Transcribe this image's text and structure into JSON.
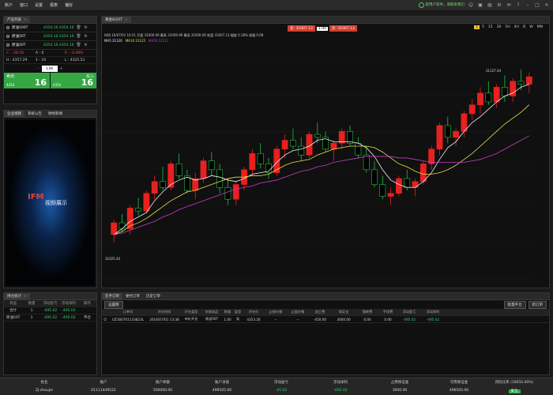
{
  "menu": [
    "账户",
    "窗口",
    "设置",
    "报表",
    "偏好"
  ],
  "status": {
    "text": "帮用户软件，请联系我们"
  },
  "products": {
    "tab": "产品列表",
    "rows": [
      {
        "name": "原油100T",
        "bid": "4354.16",
        "ask": "4354.16"
      },
      {
        "name": "原油50T",
        "bid": "4354.16",
        "ask": "4354.16"
      },
      {
        "name": "原油20T",
        "bid": "4354.16",
        "ask": "4354.16"
      }
    ],
    "stats1": [
      "C : -28.59",
      "A : 0",
      "R : -0.48%"
    ],
    "stats2": [
      "H : 4357.29",
      "1 - 10",
      "L : 4325.51"
    ],
    "qty": "1.00",
    "sell": {
      "label": "卖出",
      "big": "16",
      "small": "4354"
    },
    "buy": {
      "label": "买入",
      "big": "16",
      "small": "4354"
    }
  },
  "news": {
    "tabs": [
      "企业视频",
      "系统公告",
      "财经新闻"
    ],
    "video_label": "视频展示",
    "logo_text": "IFM"
  },
  "chart_panel": {
    "tab": "黄金8/20T",
    "sell_label": "卖: 31007.13",
    "qty": "1.00",
    "buy_label": "买: 31007.13",
    "periods": [
      "1",
      "5",
      "15",
      "30",
      "1H",
      "4H",
      "D",
      "W",
      "MN"
    ],
    "active_period": "1",
    "info": "时间 16/07/01 10:51  开盘 31000.00  最高 31009.99  最低 31000.00  收盘 31007.13  幅度 0.18%  振幅 0.08",
    "ma": [
      {
        "text": "MA5 31120",
        "color": "#f0f0f0"
      },
      {
        "text": "MA10 31125",
        "color": "#e8e04a"
      },
      {
        "text": "MA20 31111",
        "color": "#c040c0"
      }
    ],
    "price_left": "31025.44",
    "price_right": "31127.44"
  },
  "chart_data": {
    "type": "candlestick",
    "ylim": [
      30990,
      31140
    ],
    "candles": [
      [
        31020,
        31030,
        31015,
        31028
      ],
      [
        31028,
        31034,
        31022,
        31024
      ],
      [
        31024,
        31040,
        31020,
        31038
      ],
      [
        31038,
        31045,
        31033,
        31036
      ],
      [
        31036,
        31050,
        31034,
        31048
      ],
      [
        31048,
        31060,
        31044,
        31056
      ],
      [
        31056,
        31066,
        31050,
        31052
      ],
      [
        31052,
        31070,
        31050,
        31068
      ],
      [
        31068,
        31075,
        31058,
        31060
      ],
      [
        31060,
        31064,
        31048,
        31050
      ],
      [
        31050,
        31062,
        31044,
        31058
      ],
      [
        31058,
        31072,
        31055,
        31070
      ],
      [
        31070,
        31076,
        31060,
        31064
      ],
      [
        31064,
        31068,
        31048,
        31052
      ],
      [
        31052,
        31058,
        31040,
        31044
      ],
      [
        31044,
        31056,
        31040,
        31054
      ],
      [
        31054,
        31066,
        31050,
        31064
      ],
      [
        31064,
        31078,
        31060,
        31075
      ],
      [
        31075,
        31082,
        31065,
        31068
      ],
      [
        31068,
        31072,
        31058,
        31062
      ],
      [
        31062,
        31080,
        31060,
        31078
      ],
      [
        31078,
        31088,
        31072,
        31084
      ],
      [
        31084,
        31092,
        31078,
        31080
      ],
      [
        31080,
        31086,
        31070,
        31074
      ],
      [
        31074,
        31090,
        31072,
        31088
      ],
      [
        31088,
        31096,
        31082,
        31086
      ],
      [
        31086,
        31090,
        31076,
        31078
      ],
      [
        31078,
        31084,
        31070,
        31082
      ],
      [
        31082,
        31092,
        31078,
        31090
      ],
      [
        31090,
        31094,
        31080,
        31082
      ],
      [
        31082,
        31086,
        31072,
        31074
      ],
      [
        31074,
        31080,
        31062,
        31064
      ],
      [
        31064,
        31070,
        31052,
        31054
      ],
      [
        31054,
        31060,
        31044,
        31046
      ],
      [
        31046,
        31052,
        31040,
        31048
      ],
      [
        31048,
        31060,
        31046,
        31058
      ],
      [
        31058,
        31064,
        31050,
        31052
      ],
      [
        31052,
        31058,
        31046,
        31056
      ],
      [
        31056,
        31070,
        31054,
        31068
      ],
      [
        31068,
        31080,
        31064,
        31078
      ],
      [
        31078,
        31096,
        31074,
        31094
      ],
      [
        31094,
        31100,
        31082,
        31086
      ],
      [
        31086,
        31092,
        31080,
        31090
      ],
      [
        31090,
        31104,
        31086,
        31102
      ],
      [
        31102,
        31112,
        31098,
        31108
      ],
      [
        31108,
        31120,
        31102,
        31116
      ],
      [
        31116,
        31124,
        31108,
        31110
      ],
      [
        31110,
        31122,
        31106,
        31120
      ],
      [
        31120,
        31128,
        31110,
        31114
      ],
      [
        31114,
        31126,
        31110,
        31124
      ],
      [
        31124,
        31132,
        31118,
        31122
      ],
      [
        31122,
        31130,
        31116,
        31127
      ]
    ],
    "series": [
      {
        "name": "MA5",
        "color": "#f0f0f0",
        "values": [
          31020,
          31024,
          31029,
          31032,
          31035,
          31043,
          31049,
          31054,
          31057,
          31059,
          31057,
          31058,
          31060,
          31059,
          31057,
          31056,
          31058,
          31061,
          31062,
          31063,
          31069,
          31074,
          31077,
          31078,
          31080,
          31084,
          31085,
          31083,
          31083,
          31083,
          31082,
          31079,
          31073,
          31064,
          31057,
          31054,
          31052,
          31052,
          31056,
          31062,
          31071,
          31079,
          31083,
          31090,
          31096,
          31100,
          31105,
          31110,
          31114,
          31116,
          31120,
          31122
        ]
      },
      {
        "name": "MA10",
        "color": "#e8e04a",
        "values": [
          31020,
          31022,
          31026,
          31028,
          31031,
          31035,
          31039,
          31043,
          31046,
          31049,
          31050,
          31052,
          31054,
          31056,
          31058,
          31059,
          31059,
          31060,
          31060,
          31061,
          31064,
          31067,
          31069,
          31070,
          31071,
          31074,
          31076,
          31078,
          31079,
          31080,
          31080,
          31080,
          31079,
          31076,
          31072,
          31068,
          31066,
          31063,
          31061,
          31061,
          31062,
          31064,
          31067,
          31071,
          31075,
          31080,
          31085,
          31090,
          31095,
          31099,
          31103,
          31108
        ]
      },
      {
        "name": "MA20",
        "color": "#c040c0",
        "values": [
          31020,
          31021,
          31023,
          31025,
          31027,
          31029,
          31032,
          31034,
          31037,
          31039,
          31041,
          31043,
          31045,
          31047,
          31049,
          31051,
          31052,
          31053,
          31055,
          31056,
          31057,
          31059,
          31061,
          31063,
          31064,
          31066,
          31067,
          31069,
          31070,
          31071,
          31072,
          31073,
          31073,
          31073,
          31073,
          31072,
          31072,
          31071,
          31070,
          31069,
          31069,
          31069,
          31069,
          31069,
          31070,
          31071,
          31073,
          31075,
          31078,
          31081,
          31084,
          31087
        ]
      }
    ]
  },
  "positions_summary": {
    "tab": "持仓统计",
    "headers": [
      "商品",
      "数量",
      "浮动盈亏",
      "浮动净利",
      "操作"
    ],
    "rows": [
      [
        "合计",
        "1",
        "-495.02",
        "-495.02",
        ""
      ],
      [
        "原油50T",
        "1",
        "-495.02",
        "-495.02",
        "平仓"
      ]
    ]
  },
  "orders": {
    "tabs": [
      "在手订单",
      "委托订单",
      "历史订单"
    ],
    "sub_btn": "设置网",
    "btn_close_all": "批量平仓",
    "btn_new": "新订单",
    "headers": [
      "",
      "订单号",
      "开仓时间",
      "开仓类型",
      "交易商品",
      "数量",
      "类型",
      "开仓价",
      "止损价格",
      "止盈价格",
      "加工费",
      "保证金",
      "隔夜费",
      "手续费",
      "浮动盈亏",
      "浮动净利",
      "",
      ""
    ],
    "row": [
      "O",
      "UZ160701133823L",
      "2016/07/01 13:38",
      "市价开仓",
      "原油50T",
      "1.00",
      "卖",
      "4353.26",
      "--",
      "--",
      "-450.00",
      "3000.00",
      "0.00",
      "0.00",
      "-495.02",
      "-495.02",
      "",
      ""
    ]
  },
  "footer": [
    {
      "h": "姓名",
      "v": "Zj-zhoujie"
    },
    {
      "h": "账户",
      "v": "01111449522"
    },
    {
      "h": "账户余额",
      "v": "500000.00"
    },
    {
      "h": "账户净值",
      "v": "499505.00"
    },
    {
      "h": "浮动盈亏",
      "v": "-45.02"
    },
    {
      "h": "浮动净利",
      "v": "-495.02"
    },
    {
      "h": "占用保证金",
      "v": "3000.00"
    },
    {
      "h": "可用保证金",
      "v": "496505.00"
    },
    {
      "h": "风险比率 (16650.00%)",
      "v": "安全"
    }
  ]
}
